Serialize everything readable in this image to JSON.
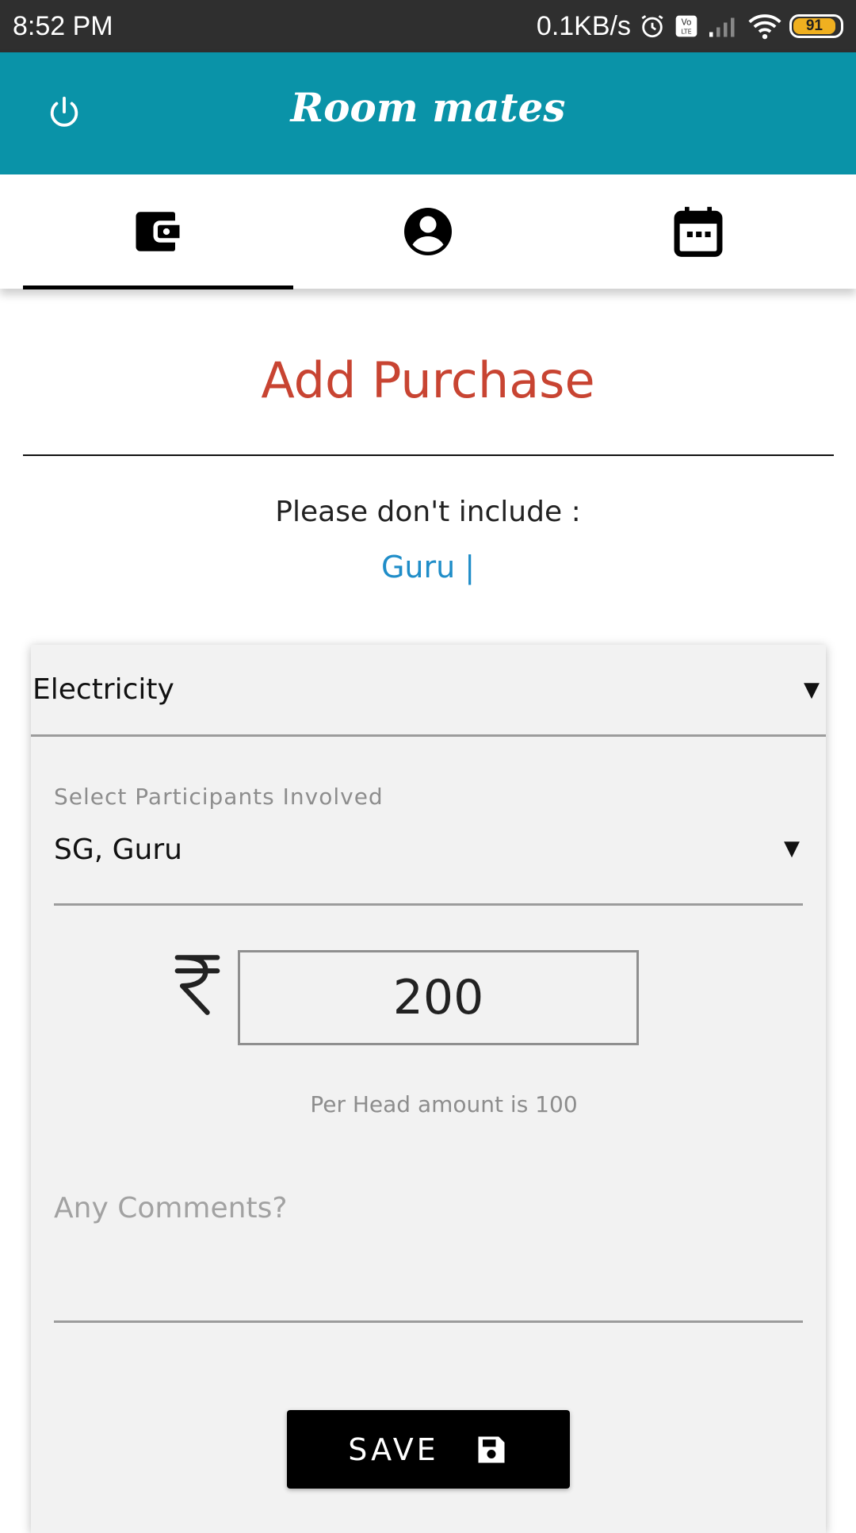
{
  "status_bar": {
    "time": "8:52 PM",
    "network_speed": "0.1KB/s",
    "battery_level": "91",
    "icons": [
      "alarm-icon",
      "volte-icon",
      "signal-icon",
      "wifi-icon",
      "battery-icon"
    ]
  },
  "app_bar": {
    "title": "Room mates",
    "power_icon": "power-icon"
  },
  "tabs": [
    {
      "name": "wallet",
      "icon": "wallet-icon",
      "selected": true
    },
    {
      "name": "profile",
      "icon": "account-circle-icon",
      "selected": false
    },
    {
      "name": "calendar",
      "icon": "calendar-icon",
      "selected": false
    }
  ],
  "page": {
    "title": "Add Purchase",
    "notice_label": "Please don't include :",
    "notice_names": "Guru |"
  },
  "form": {
    "category": "Electricity",
    "participants_label": "Select Participants Involved",
    "participants_value": "SG, Guru",
    "currency_icon": "rupee-icon",
    "amount": "200",
    "per_head_text": "Per Head amount is 100",
    "comments_placeholder": "Any Comments?",
    "comments_value": "",
    "save_label": "SAVE",
    "caret": "▼"
  },
  "colors": {
    "status_bar": "#2f2f2f",
    "app_bar": "#0a93a8",
    "title_red": "#c84432",
    "names_blue": "#1f8dc8",
    "card_bg": "#f2f2f2"
  }
}
